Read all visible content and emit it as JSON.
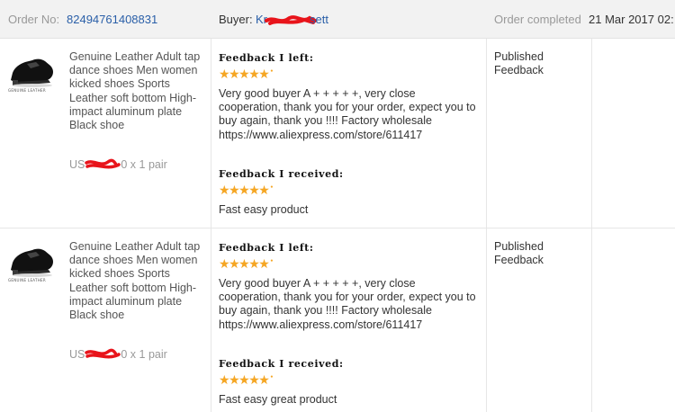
{
  "header": {
    "order_label": "Order No:",
    "order_number": "82494761408831",
    "buyer_label": "Buyer:",
    "buyer_name": "Kr",
    "buyer_name_end": "sett",
    "completed_label": "Order completed",
    "completed_date": "21 Mar 2017 02:"
  },
  "colors": {
    "link": "#2a5fa8",
    "star": "#f5a623",
    "header_bg": "#f2f2f2",
    "redaction": "#e8141b"
  },
  "orders": [
    {
      "product_name": "Genuine Leather Adult tap dance shoes Men women kicked shoes Sports Leather soft bottom High-impact aluminum plate Black shoe",
      "thumb_caption": "GENUINE LEATHER",
      "price_prefix": "US",
      "price_suffix": "0 x 1 pair",
      "feedback_left_title": "Feedback I left:",
      "feedback_left_stars": 5,
      "feedback_left_text": "Very good buyer A + + + + +, very close cooperation, thank you for your order, expect you to buy again, thank you !!!! Factory wholesale https://www.aliexpress.com/store/611417",
      "feedback_received_title": "Feedback I received:",
      "feedback_received_stars": 5,
      "feedback_received_text": "Fast easy product",
      "status": "Published Feedback"
    },
    {
      "product_name": "Genuine Leather Adult tap dance shoes Men women kicked shoes Sports Leather soft bottom High-impact aluminum plate Black shoe",
      "thumb_caption": "GENUINE LEATHER",
      "price_prefix": "US",
      "price_suffix": "0 x 1 pair",
      "feedback_left_title": "Feedback I left:",
      "feedback_left_stars": 5,
      "feedback_left_text": "Very good buyer A + + + + +, very close cooperation, thank you for your order, expect you to buy again, thank you !!!! Factory wholesale https://www.aliexpress.com/store/611417",
      "feedback_received_title": "Feedback I received:",
      "feedback_received_stars": 5,
      "feedback_received_text": "Fast easy great product",
      "status": "Published Feedback"
    }
  ]
}
